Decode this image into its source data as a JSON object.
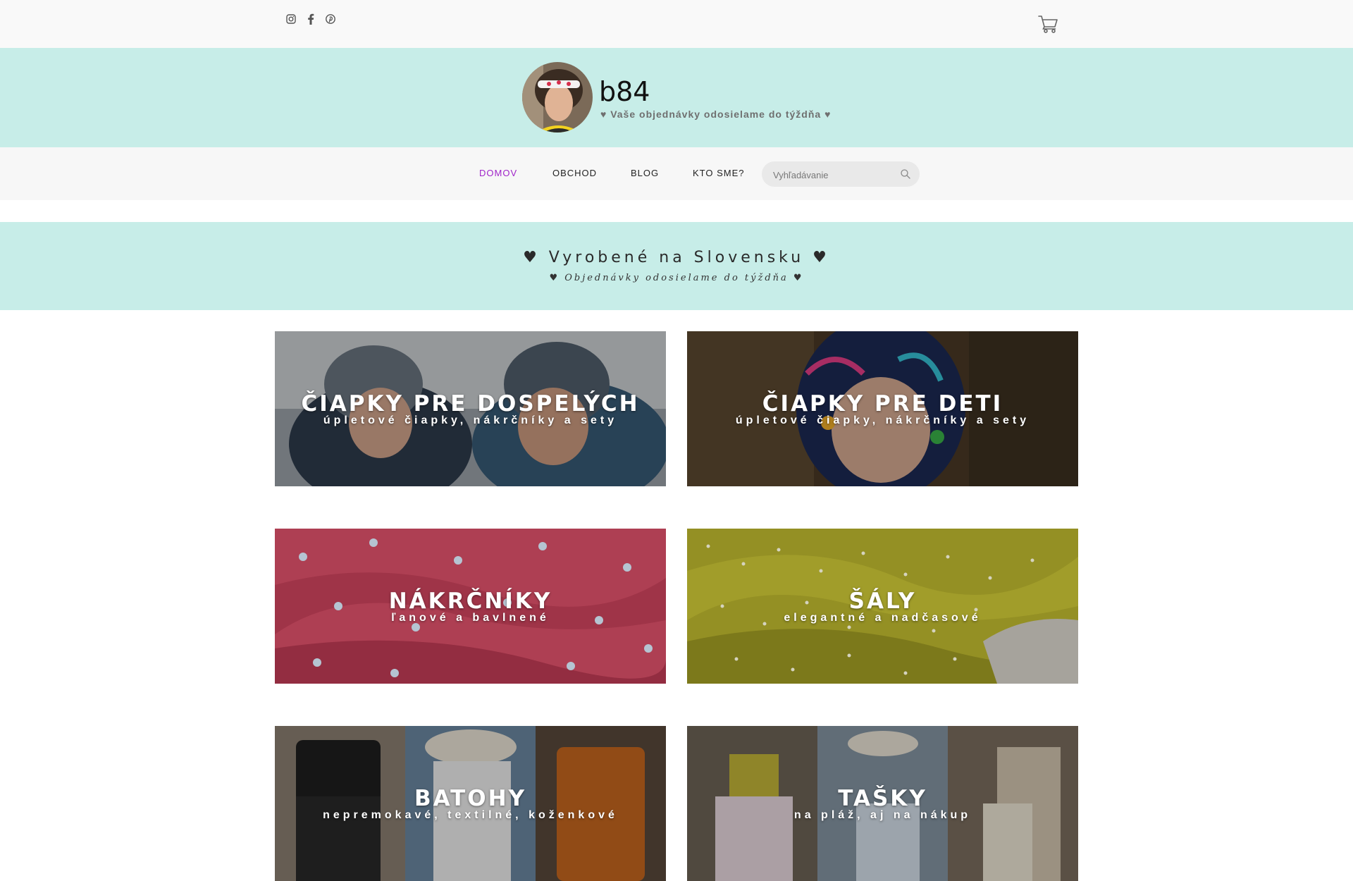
{
  "social": {
    "icons": [
      "instagram-icon",
      "facebook-icon",
      "pinterest-icon"
    ]
  },
  "cart": {
    "icon": "cart-icon"
  },
  "brand": {
    "name": "b84",
    "tagline": "♥ Vaše objednávky odosielame do týždňa ♥"
  },
  "nav": {
    "items": [
      {
        "label": "DOMOV",
        "active": true
      },
      {
        "label": "OBCHOD",
        "active": false
      },
      {
        "label": "BLOG",
        "active": false
      },
      {
        "label": "KTO SME?",
        "active": false
      }
    ],
    "search_placeholder": "Vyhľadávanie",
    "active_color": "#a025c9"
  },
  "hero": {
    "title": "♥ Vyrobené na Slovensku ♥",
    "subtitle": "♥ Objednávky odosielame do týždňa ♥"
  },
  "colors": {
    "band": "#c7ede8",
    "topbar": "#f9f9f9"
  },
  "categories": [
    {
      "title": "ČIAPKY PRE DOSPELÝCH",
      "subtitle": "úpletové čiapky, nákrčníky a sety"
    },
    {
      "title": "ČIAPKY PRE DETI",
      "subtitle": "úpletové čiapky, nákrčníky a sety"
    },
    {
      "title": "NÁKRČNÍKY",
      "subtitle": "ľanové a bavlnené"
    },
    {
      "title": "ŠÁLY",
      "subtitle": "elegantné a nadčasové"
    },
    {
      "title": "BATOHY",
      "subtitle": "nepremokavé, textilné, koženkové"
    },
    {
      "title": "TAŠKY",
      "subtitle": "na pláž, aj na nákup"
    }
  ]
}
